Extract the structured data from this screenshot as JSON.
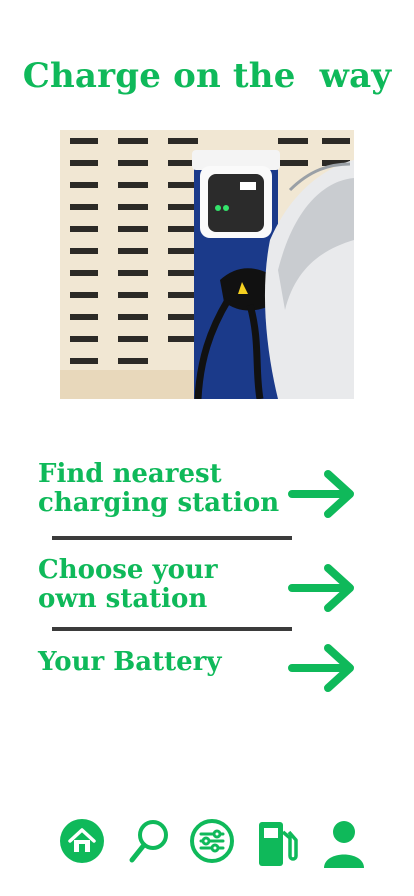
{
  "header": {
    "title": "Charge on the  way"
  },
  "hero": {
    "image": "ev-charging-station-photo"
  },
  "menu": {
    "items": [
      {
        "label_line1": "Find nearest",
        "label_line2": "charging station",
        "icon": "arrow-right-icon"
      },
      {
        "label_line1": "Choose your",
        "label_line2": "own station",
        "icon": "arrow-right-icon"
      },
      {
        "label_line1": "Your Battery",
        "label_line2": "",
        "icon": "arrow-right-icon"
      }
    ]
  },
  "bottom_nav": {
    "items": [
      {
        "icon": "home-icon"
      },
      {
        "icon": "search-icon"
      },
      {
        "icon": "sliders-icon"
      },
      {
        "icon": "fuel-pump-icon"
      },
      {
        "icon": "user-icon"
      }
    ]
  },
  "colors": {
    "accent": "#0fb95a",
    "divider": "#3b3b3b"
  }
}
